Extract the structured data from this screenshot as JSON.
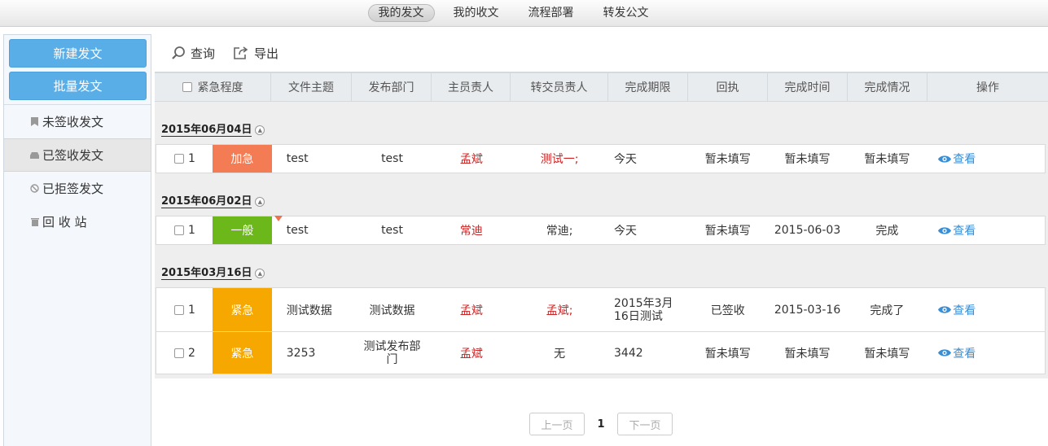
{
  "nav": {
    "tabs": [
      {
        "label": "我的发文",
        "active": true
      },
      {
        "label": "我的收文",
        "active": false
      },
      {
        "label": "流程部署",
        "active": false
      },
      {
        "label": "转发公文",
        "active": false
      }
    ]
  },
  "sidebar": {
    "new_button": "新建发文",
    "batch_button": "批量发文",
    "items": [
      {
        "label": "未签收发文",
        "icon": "bookmark-icon"
      },
      {
        "label": "已签收发文",
        "icon": "inbox-icon",
        "active": true
      },
      {
        "label": "已拒签发文",
        "icon": "ban-icon"
      },
      {
        "label": "回 收 站",
        "icon": "trash-icon"
      }
    ]
  },
  "toolbar": {
    "query_label": "查询",
    "export_label": "导出"
  },
  "table": {
    "headers": [
      "紧急程度",
      "文件主题",
      "发布部门",
      "主员责人",
      "转交员责人",
      "完成期限",
      "回执",
      "完成时间",
      "完成情况",
      "操作"
    ],
    "view_label": "查看",
    "groups": [
      {
        "date": "2015年06月04日",
        "rows": [
          {
            "no": "1",
            "urgency": "加急",
            "urgency_color": "#f47c55",
            "subject": "test",
            "dept": "test",
            "owner": "孟斌",
            "transfer": "测试一;",
            "transfer_red": true,
            "deadline": "今天",
            "receipt": "暂未填写",
            "done_time": "暂未填写",
            "status": "暂未填写"
          }
        ]
      },
      {
        "date": "2015年06月02日",
        "rows": [
          {
            "no": "1",
            "urgency": "一般",
            "urgency_color": "#6cb81b",
            "subject": "test",
            "dept": "test",
            "owner": "常迪",
            "transfer": "常迪;",
            "transfer_red": false,
            "deadline": "今天",
            "receipt": "暂未填写",
            "done_time": "2015-06-03",
            "status": "完成",
            "flag": true
          }
        ]
      },
      {
        "date": "2015年03月16日",
        "rows": [
          {
            "no": "1",
            "urgency": "紧急",
            "urgency_color": "#f7a800",
            "subject": "测试数据",
            "dept": "测试数据",
            "owner": "孟斌",
            "transfer": "孟斌;",
            "transfer_red": true,
            "deadline": "2015年3月\n16日测试",
            "receipt": "已签收",
            "done_time": "2015-03-16",
            "status": "完成了"
          },
          {
            "no": "2",
            "urgency": "紧急",
            "urgency_color": "#f7a800",
            "subject": "3253",
            "dept": "测试发布部\n门",
            "owner": "孟斌",
            "transfer": "无",
            "transfer_red": false,
            "deadline": "3442",
            "receipt": "暂未填写",
            "done_time": "暂未填写",
            "status": "暂未填写"
          }
        ]
      }
    ]
  },
  "pager": {
    "prev": "上一页",
    "current": "1",
    "next": "下一页"
  }
}
